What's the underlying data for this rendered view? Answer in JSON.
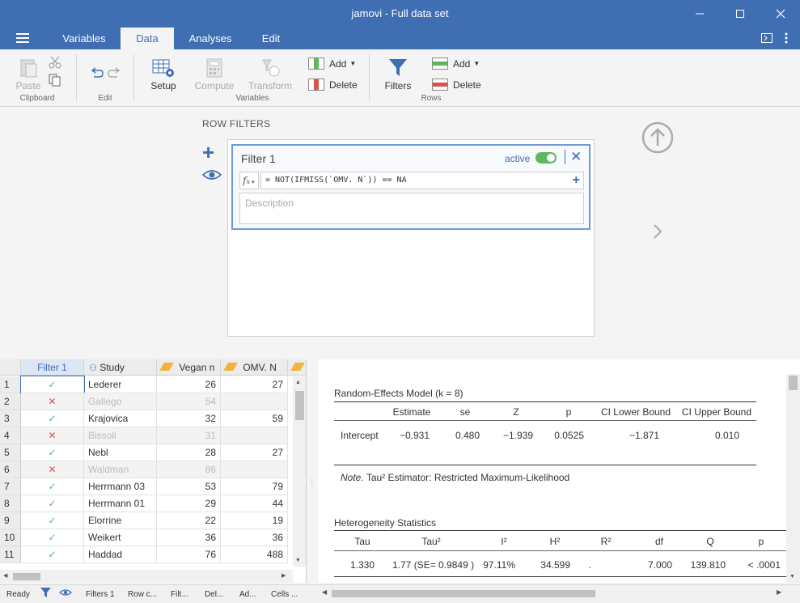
{
  "window": {
    "title": "jamovi - Full data set"
  },
  "menu": {
    "tabs": [
      {
        "label": "Variables"
      },
      {
        "label": "Data"
      },
      {
        "label": "Analyses"
      },
      {
        "label": "Edit"
      }
    ],
    "active_tab": "Data"
  },
  "ribbon": {
    "paste": "Paste",
    "clipboard": "Clipboard",
    "edit": "Edit",
    "setup": "Setup",
    "compute": "Compute",
    "transform": "Transform",
    "variables": "Variables",
    "var_add": "Add",
    "var_delete": "Delete",
    "filters": "Filters",
    "row_add": "Add",
    "row_delete": "Delete",
    "rows": "Rows"
  },
  "filters": {
    "section_label": "ROW FILTERS",
    "filter": {
      "name": "Filter 1",
      "status": "active",
      "formula": "= NOT(IFMISS(`OMV. N`)) == NA",
      "description_placeholder": "Description"
    }
  },
  "sheet": {
    "columns": [
      "Filter 1",
      "Study",
      "Vegan n",
      "OMV. N"
    ],
    "rows": [
      {
        "num": "1",
        "pass": true,
        "study": "Lederer",
        "vegan": "26",
        "omv": "27"
      },
      {
        "num": "2",
        "pass": false,
        "study": "Gallego",
        "vegan": "54",
        "omv": ""
      },
      {
        "num": "3",
        "pass": true,
        "study": "Krajovica",
        "vegan": "32",
        "omv": "59"
      },
      {
        "num": "4",
        "pass": false,
        "study": "Bissoli",
        "vegan": "31",
        "omv": ""
      },
      {
        "num": "5",
        "pass": true,
        "study": "Nebl",
        "vegan": "28",
        "omv": "27"
      },
      {
        "num": "6",
        "pass": false,
        "study": "Waldman",
        "vegan": "86",
        "omv": ""
      },
      {
        "num": "7",
        "pass": true,
        "study": "Herrmann 03",
        "vegan": "53",
        "omv": "79"
      },
      {
        "num": "8",
        "pass": true,
        "study": "Herrmann 01",
        "vegan": "29",
        "omv": "44"
      },
      {
        "num": "9",
        "pass": true,
        "study": "Elorrine",
        "vegan": "22",
        "omv": "19"
      },
      {
        "num": "10",
        "pass": true,
        "study": "Weikert",
        "vegan": "36",
        "omv": "36"
      },
      {
        "num": "11",
        "pass": true,
        "study": "Haddad",
        "vegan": "76",
        "omv": "488"
      }
    ]
  },
  "results": {
    "rem_title": "Random-Effects Model (k = 8)",
    "rem_headers": [
      "Estimate",
      "se",
      "Z",
      "p",
      "CI Lower Bound",
      "CI Upper Bound"
    ],
    "rem_row": {
      "label": "Intercept",
      "values": [
        "−0.931",
        "0.480",
        "−1.939",
        "0.0525",
        "−1.871",
        "0.010"
      ]
    },
    "note_label": "Note.",
    "note_text": "Tau² Estimator: Restricted Maximum-Likelihood",
    "het_title": "Heterogeneity Statistics",
    "het_headers": [
      "Tau",
      "Tau²",
      "I²",
      "H²",
      "R²",
      "df",
      "Q",
      "p"
    ],
    "het_values": [
      "1.330",
      "1.77 (SE= 0.9849 )",
      "97.11%",
      "34.599",
      ".",
      "7.000",
      "139.810",
      "< .0001"
    ]
  },
  "status": {
    "ready": "Ready",
    "filters": "Filters 1",
    "row_count": "Row c...",
    "filtered": "Filt...",
    "deleted": "Del...",
    "added": "Ad...",
    "cells": "Cells ..."
  },
  "colors": {
    "brand": "#3f6eb3",
    "check": "#5cb85c",
    "cross": "#d9534f"
  }
}
